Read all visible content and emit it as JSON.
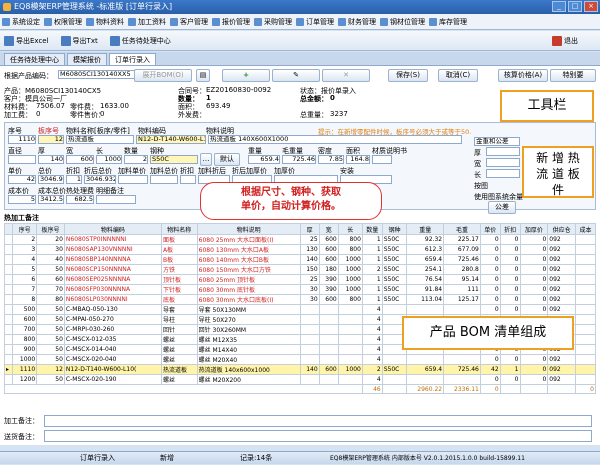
{
  "window": {
    "title": "EQ8模架ERP管理系统 -标准版 [订单行录入]"
  },
  "menu": [
    "系统设定",
    "权限管理",
    "物料资料",
    "加工资料",
    "客户管理",
    "报价管理",
    "采购管理",
    "订单管理",
    "财务管理",
    "钢材位管理",
    "库存管理"
  ],
  "toolbar": {
    "export_excel": "导出Excel",
    "export_txt": "导出Txt",
    "task_center": "任务待处理中心",
    "exit": "退出"
  },
  "tabs": [
    "任务待处理中心",
    "模架报价",
    "订单行录入"
  ],
  "form": {
    "product_code_label": "根据产品编码：",
    "product_code": "M6080SCI130140XX5",
    "btn_open_bom": "展开BOM(O)",
    "btn_save": "保存(S)",
    "btn_cancel": "取消(C)",
    "btn_quote": "核算价格(A)",
    "btn_special": "特别要",
    "product_line": "产品：M6080SCI130140CX5",
    "contract_label": "合同号：",
    "contract": "EZ20160830-0092",
    "status_label": "状态：报价单录入",
    "customer_line": "客户：模具公司一厂",
    "qty_label": "数量：",
    "qty": "1",
    "total_label": "总金额：",
    "total": "0",
    "mat_fee_label": "材料费：",
    "mat_fee": "7506.07",
    "part_fee_label": "零件费：",
    "part_fee": "1633.00",
    "area_label": "面积：",
    "area": "693.49",
    "proc_fee_label": "加工费：",
    "proc_fee": "0",
    "part_sale_label": "零件售价：",
    "part_sale": "0",
    "outer_label": "外发费：",
    "outer": "",
    "weight_label": "总重量：",
    "weight": "3237"
  },
  "hint": "提示：在新增零配件时候，板序号必须大于或等于50.",
  "detail": {
    "h_seq": "序号",
    "h_board_no": "板序号",
    "h_name": "物料名称[板序/零件]",
    "h_code": "物料编码",
    "h_desc": "物料说明",
    "seq": "1110",
    "board_no": "12",
    "name": "热流道板",
    "code": "N12-D-T140-W600-L1000",
    "desc": "热流道板 140X600X1000",
    "h_dia": "直径",
    "h_thick": "厚",
    "h_width": "宽",
    "h_long": "长",
    "h_count": "数量",
    "h_steel": "钢种",
    "h_weight": "重量",
    "h_gross": "毛重量",
    "h_density": "密度",
    "h_area": "面积",
    "h_doc": "材质说明书",
    "dia": "",
    "thick": "140",
    "width": "600",
    "long": "1000",
    "count": "2",
    "steel": "S50C",
    "weight": "659.4",
    "gross": "725.46",
    "density": "7.85",
    "area_v": "164.8",
    "doc": "默认",
    "h_unit": "单价",
    "h_total": "总价",
    "h_discount": "折扣",
    "h_after": "折后总价",
    "h_proc_unit": "加料单价",
    "h_proc_total": "加料总价",
    "h_proc_disc": "折扣",
    "h_proc_after": "加料折后",
    "h_plate": "折后加厚价",
    "h_install": "加厚价",
    "h_assemble": "安装",
    "unit": "42",
    "total": "3046.932",
    "discount": "1",
    "after": "3046.932",
    "h_cost": "成本价",
    "h_cost_total": "成本总价",
    "h_heat": "热处理费",
    "h_heat_note": "明细备注",
    "cost": "5",
    "cost_total": "3412.5",
    "heat": "682.5",
    "side_gold": "金重和公差",
    "side_thick": "厚",
    "side_wide": "宽",
    "side_long": "长",
    "side_tol": "按图",
    "side_use": "使用图系统余量",
    "btn_gong": "公差",
    "btn_def": "默认"
  },
  "hot_note_label": "热加工备注",
  "table": {
    "headers": [
      "序号",
      "板序号",
      "物料编码",
      "物料名称",
      "物料说明",
      "厚",
      "宽",
      "长",
      "数量",
      "钢种",
      "重量",
      "毛重",
      "单价",
      "折扣",
      "加厚价",
      "供应仓",
      "成本"
    ],
    "rows": [
      [
        "2",
        "20",
        "N6080STP0INNNNNI",
        "面板",
        "6080 25mm 大水口面板(I)",
        "25",
        "600",
        "800",
        "1",
        "S50C",
        "92.32",
        "225.17",
        "0",
        "0",
        "0",
        "092",
        ""
      ],
      [
        "3",
        "30",
        "N6080SAP130VNNNNI",
        "A板",
        "6080 130mm 大水口A板",
        "130",
        "600",
        "800",
        "1",
        "S50C",
        "612.3",
        "677.09",
        "0",
        "0",
        "0",
        "092",
        ""
      ],
      [
        "4",
        "40",
        "N6080SBP140NNNNA",
        "B板",
        "6080 140mm 大水口B板",
        "140",
        "600",
        "1000",
        "1",
        "S50C",
        "659.4",
        "725.46",
        "0",
        "0",
        "0",
        "092",
        ""
      ],
      [
        "5",
        "50",
        "N6080SCP150NNNNA",
        "方铁",
        "6080 150mm 大水口方铁",
        "150",
        "180",
        "1000",
        "2",
        "S50C",
        "254.1",
        "280.8",
        "0",
        "0",
        "0",
        "092",
        ""
      ],
      [
        "6",
        "60",
        "N6080SEP025NNNNA",
        "顶针板",
        "6080 25mm 顶针板",
        "25",
        "390",
        "1000",
        "1",
        "S50C",
        "76.54",
        "95.14",
        "0",
        "0",
        "0",
        "092",
        ""
      ],
      [
        "7",
        "70",
        "N6080SFP030NNNNA",
        "下针板",
        "6080 30mm 底针板",
        "30",
        "390",
        "1000",
        "1",
        "S50C",
        "91.84",
        "111",
        "0",
        "0",
        "0",
        "092",
        ""
      ],
      [
        "8",
        "80",
        "N6080SLP030NNNNI",
        "底板",
        "6080 30mm 大水口底板(I)",
        "30",
        "600",
        "800",
        "1",
        "S50C",
        "113.04",
        "125.17",
        "0",
        "0",
        "0",
        "092",
        ""
      ],
      [
        "500",
        "50",
        "C-MBAQ-050-130",
        "导套",
        "导套 50X130MM",
        "",
        "",
        "",
        "4",
        "",
        "",
        "",
        "0",
        "0",
        "0",
        "092",
        ""
      ],
      [
        "600",
        "50",
        "C-MPAI-050-270",
        "导柱",
        "导柱 50X270",
        "",
        "",
        "",
        "4",
        "",
        "",
        "",
        "0",
        "0",
        "0",
        "092",
        ""
      ],
      [
        "700",
        "50",
        "C-MRPI-030-260",
        "回针",
        "回针 30X260MM",
        "",
        "",
        "",
        "4",
        "",
        "",
        "",
        "0",
        "0",
        "0",
        "092",
        ""
      ],
      [
        "800",
        "50",
        "C-MSCX-012-035",
        "螺丝",
        "螺丝 M12X35",
        "",
        "",
        "",
        "4",
        "",
        "",
        "",
        "0",
        "0",
        "0",
        "092",
        ""
      ],
      [
        "900",
        "50",
        "C-MSCX-014-040",
        "螺丝",
        "螺丝 M14X40",
        "",
        "",
        "",
        "4",
        "",
        "",
        "",
        "0",
        "0",
        "0",
        "092",
        ""
      ],
      [
        "1000",
        "50",
        "C-MSCX-020-040",
        "螺丝",
        "螺丝 M20X40",
        "",
        "",
        "",
        "4",
        "",
        "",
        "",
        "0",
        "0",
        "0",
        "092",
        ""
      ],
      [
        "1110",
        "12",
        "N12-D-T140-W600-L10(",
        "热流道板",
        "热流道板 140x600x1000",
        "140",
        "600",
        "1000",
        "2",
        "S50C",
        "659.4",
        "725.46",
        "42",
        "1",
        "0",
        "092",
        ""
      ],
      [
        "1200",
        "50",
        "C-MSCX-020-190",
        "螺丝",
        "螺丝 M20X200",
        "",
        "",
        "",
        "4",
        "",
        "",
        "",
        "0",
        "0",
        "0",
        "092",
        ""
      ]
    ],
    "sum_count": "46",
    "sum_weight": "2960.22",
    "sum_gross": "2336.11",
    "sum_unit": "0",
    "sum_cost": "0"
  },
  "notes": {
    "process_label": "加工备注：",
    "delivery_label": "送货备注："
  },
  "annotations": {
    "toolbar": "工具栏",
    "new_hot": "新 增 热\n流 道 板\n件",
    "price_note": "根据尺寸、钢种、获取\n单价，自动计算价格。",
    "bom": "产品 BOM 清单组成"
  },
  "status": {
    "form": "订单行录入",
    "mode": "新增",
    "records": "记录:14条",
    "version": "EQ8模架ERP管理系统 内部版本号 V2.0.1.2015.1.0.0 build-15899.11"
  }
}
